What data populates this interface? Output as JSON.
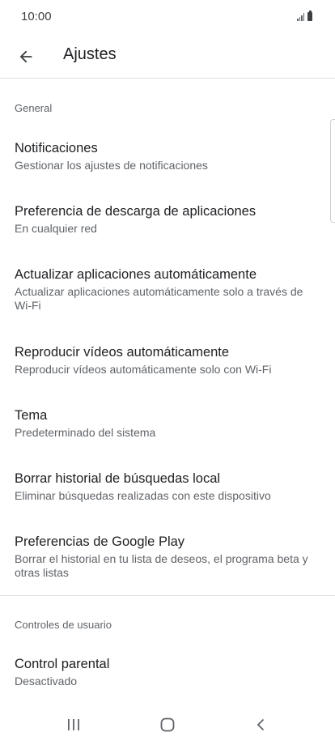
{
  "status_bar": {
    "time": "10:00"
  },
  "app_bar": {
    "title": "Ajustes"
  },
  "sections": {
    "general": "General",
    "user_controls": "Controles de usuario"
  },
  "settings": [
    {
      "title": "Notificaciones",
      "subtitle": "Gestionar los ajustes de notificaciones"
    },
    {
      "title": "Preferencia de descarga de aplicaciones",
      "subtitle": "En cualquier red"
    },
    {
      "title": "Actualizar aplicaciones automáticamente",
      "subtitle": "Actualizar aplicaciones automáticamente solo a través de Wi-Fi"
    },
    {
      "title": "Reproducir vídeos automáticamente",
      "subtitle": "Reproducir vídeos automáticamente solo con Wi-Fi"
    },
    {
      "title": "Tema",
      "subtitle": "Predeterminado del sistema"
    },
    {
      "title": "Borrar historial de búsquedas local",
      "subtitle": "Eliminar búsquedas realizadas con este dispositivo"
    },
    {
      "title": "Preferencias de Google Play",
      "subtitle": "Borrar el historial en tu lista de deseos, el programa beta y otras listas"
    },
    {
      "title": "Control parental",
      "subtitle": "Desactivado"
    }
  ],
  "icons": {
    "back": "arrow-back-icon",
    "signal": "signal-icon",
    "battery": "battery-icon",
    "recents": "recents-icon",
    "home": "home-icon",
    "nav_back": "nav-back-icon"
  }
}
